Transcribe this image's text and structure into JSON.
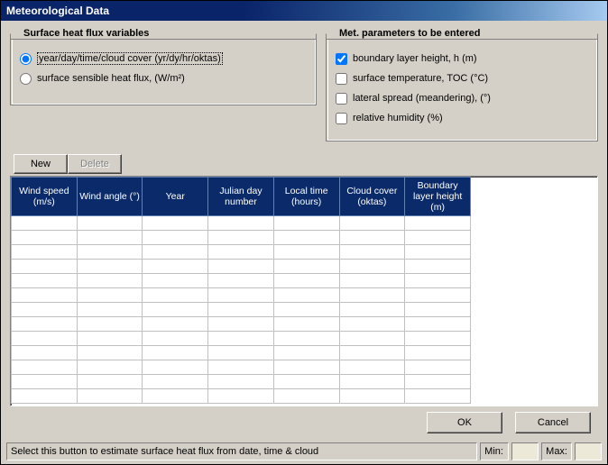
{
  "title": "Meteorological Data",
  "surface_group": {
    "legend": "Surface heat flux variables",
    "opt1": "year/day/time/cloud cover (yr/dy/hr/oktas)",
    "opt2": "surface sensible heat flux, (W/m²)"
  },
  "met_group": {
    "legend": "Met. parameters to be entered",
    "chk1": "boundary layer height, h (m)",
    "chk2": "surface temperature, TOC (°C)",
    "chk3": "lateral spread (meandering), (°)",
    "chk4": "relative humidity (%)"
  },
  "buttons": {
    "new": "New",
    "delete": "Delete",
    "ok": "OK",
    "cancel": "Cancel"
  },
  "columns": {
    "c0": "Wind speed (m/s)",
    "c1": "Wind angle (°)",
    "c2": "Year",
    "c3": "Julian day number",
    "c4": "Local time (hours)",
    "c5": "Cloud cover (oktas)",
    "c6": "Boundary layer height (m)"
  },
  "status": {
    "hint": "Select this button to estimate surface heat flux from date, time & cloud",
    "min_label": "Min:",
    "min_value": "",
    "max_label": "Max:",
    "max_value": ""
  }
}
